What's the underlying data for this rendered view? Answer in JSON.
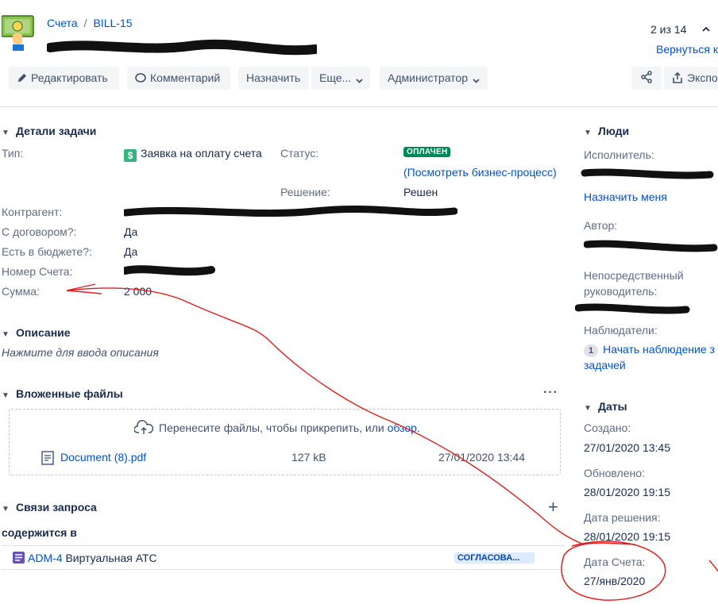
{
  "breadcrumbs": {
    "project": "Счета",
    "separator": "/",
    "issue_key": "BILL-15"
  },
  "pager": {
    "position": "2 из 14",
    "return_link": "Вернуться к"
  },
  "toolbar": {
    "edit": "Редактировать",
    "comment": "Комментарий",
    "assign": "Назначить",
    "more": "Еще...",
    "admin": "Администратор",
    "export": "Экспо"
  },
  "details": {
    "title": "Детали задачи",
    "type_label": "Тип:",
    "type_value": "Заявка на оплату счета",
    "status_label": "Статус:",
    "status_value": "ОПЛАЧЕН",
    "view_workflow": "(Посмотреть бизнес-процесс)",
    "resolution_label": "Решение:",
    "resolution_value": "Решен",
    "counterparty_label": "Контрагент:",
    "contract_label": "С договором?:",
    "contract_value": "Да",
    "budget_label": "Есть в бюджете?:",
    "budget_value": "Да",
    "invoice_no_label": "Номер Счета:",
    "sum_label": "Сумма:",
    "sum_value": "2 000"
  },
  "description": {
    "title": "Описание",
    "placeholder": "Нажмите для ввода описания"
  },
  "attachments": {
    "title": "Вложенные файлы",
    "drop_text": "Перенесите файлы, чтобы прикрепить, или",
    "browse": "обзор.",
    "files": [
      {
        "name": "Document (8).pdf",
        "size": "127 kB",
        "date": "27/01/2020 13:44"
      }
    ]
  },
  "links": {
    "title": "Связи запроса",
    "group": "содержится в",
    "items": [
      {
        "key": "ADM-4",
        "summary": "Виртуальная АТС",
        "status": "СОГЛАСОВА..."
      }
    ]
  },
  "people": {
    "title": "Люди",
    "assignee_label": "Исполнитель:",
    "assign_me": "Назначить меня",
    "reporter_label": "Автор:",
    "manager_label_1": "Непосредственный",
    "manager_label_2": "руководитель:",
    "watchers_label": "Наблюдатели:",
    "watch_count": "1",
    "start_watch_1": "Начать наблюдение з",
    "start_watch_2": "задачей"
  },
  "dates": {
    "title": "Даты",
    "created_label": "Создано:",
    "created_value": "27/01/2020 13:45",
    "updated_label": "Обновлено:",
    "updated_value": "28/01/2020 19:15",
    "resolved_label": "Дата решения:",
    "resolved_value": "28/01/2020 19:15",
    "invoice_date_label": "Дата Счета:",
    "invoice_date_value": "27/янв/2020"
  },
  "colors": {
    "link": "#0052cc",
    "status_green": "#00875a",
    "annotation": "#e02020"
  }
}
